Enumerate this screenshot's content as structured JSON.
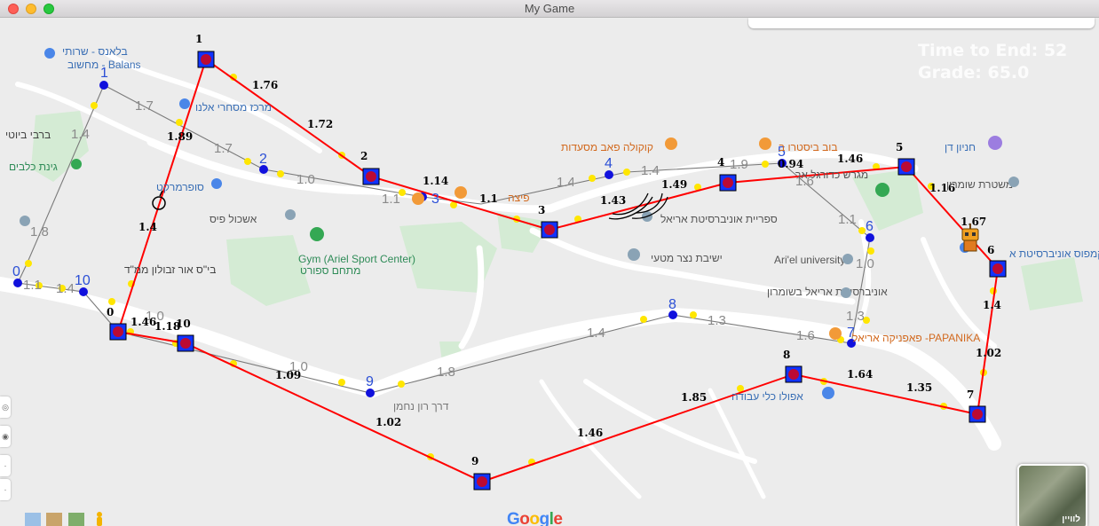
{
  "window": {
    "title": "My Game"
  },
  "hud": {
    "time_label": "Time to End: 52",
    "grade_label": "Grade: 65.0"
  },
  "graph": {
    "nodes": [
      {
        "id": "0",
        "label": "0"
      },
      {
        "id": "1",
        "label": "1"
      },
      {
        "id": "2",
        "label": "2"
      },
      {
        "id": "3",
        "label": "3"
      },
      {
        "id": "4",
        "label": "4"
      },
      {
        "id": "5",
        "label": "5"
      },
      {
        "id": "6",
        "label": "6"
      },
      {
        "id": "7",
        "label": "7"
      },
      {
        "id": "8",
        "label": "8"
      },
      {
        "id": "9",
        "label": "9"
      },
      {
        "id": "10",
        "label": "10"
      }
    ],
    "gray_weights": [
      "1.7",
      "1.4",
      "1.89",
      "1.7",
      "1.0",
      "1.1",
      "1.4",
      "1.9",
      "1.6",
      "1.1",
      "1.0",
      "1.3",
      "1.6",
      "1.3",
      "1.4",
      "1.8",
      "1.0",
      "1.0",
      "1.1",
      "1.4",
      "1.8"
    ]
  },
  "agents": [
    {
      "id": "0",
      "label": "0"
    },
    {
      "id": "1",
      "label": "1"
    },
    {
      "id": "2",
      "label": "2"
    },
    {
      "id": "3",
      "label": "3"
    },
    {
      "id": "4",
      "label": "4"
    },
    {
      "id": "5",
      "label": "5"
    },
    {
      "id": "6",
      "label": "6"
    },
    {
      "id": "7",
      "label": "7"
    },
    {
      "id": "8",
      "label": "8"
    },
    {
      "id": "9",
      "label": "9"
    },
    {
      "id": "10",
      "label": "10"
    }
  ],
  "route_weights": [
    "1.76",
    "1.72",
    "1.14",
    "1.1",
    "1.43",
    "1.49",
    "0.94",
    "1.46",
    "1.16",
    "1.67",
    "1.4",
    "1.02",
    "1.35",
    "1.64",
    "1.85",
    "1.46",
    "1.02",
    "1.09",
    "1.18",
    "1.46",
    "1.4",
    "1.89"
  ],
  "map_labels": {
    "balans_a": "בלאנס - שרותי",
    "balans_b": "מחשוב - Balans",
    "center_a": "מרכז מסחרי אלנו",
    "berbi": "ברבי ביוטי",
    "ginat": "גינת כלבים",
    "supermarket": "סופרמרקט",
    "eshkol": "אשכול פיס",
    "gym_a": "Gym (Ariel Sport Center)",
    "gym_b": "מתחם ספורט",
    "bs": "בי\"ס אור זבולון ממ\"ד",
    "kokola": "קוקולה פאב מסעדות",
    "bob": "בוב ביסטרו ב",
    "library": "ספריית אוניברסיטת אריאל",
    "netzer": "ישיבת נצר מטעי",
    "ariel_uni": "Ari'el university",
    "uni_shomron": "אוניברסיטת אריאל בשומרון",
    "papanika": "פאפניקה אריאל -PAPANIKA",
    "apolo": "אפולו כלי עבודה",
    "hanion": "חניון דן",
    "mishteret": "משטרת שומרון",
    "kampus": "קמפוס אוניברסיטת א",
    "migrash": "מגרש כדורגל אר",
    "derech": "דרך רון נחמן",
    "rechov": "הגליל",
    "pizza": "פיצה",
    "google": "Google",
    "satellite": "לוויין"
  }
}
